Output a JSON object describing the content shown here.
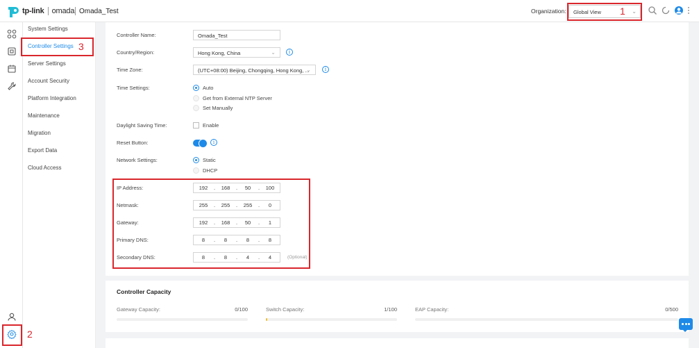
{
  "header": {
    "brand": "tp-link",
    "product": "omada",
    "site_name": "Omada_Test",
    "organization_label": "Organization:",
    "organization_value": "Global View"
  },
  "subnav": {
    "items": [
      {
        "label": "System Settings"
      },
      {
        "label": "Controller Settings"
      },
      {
        "label": "Server Settings"
      },
      {
        "label": "Account Security"
      },
      {
        "label": "Platform Integration"
      },
      {
        "label": "Maintenance"
      },
      {
        "label": "Migration"
      },
      {
        "label": "Export Data"
      },
      {
        "label": "Cloud Access"
      }
    ]
  },
  "form": {
    "controller_name_label": "Controller Name:",
    "controller_name_value": "Omada_Test",
    "country_label": "Country/Region:",
    "country_value": "Hong Kong, China",
    "timezone_label": "Time Zone:",
    "timezone_value": "(UTC+08:00) Beijing, Chongqing, Hong Kong, ...",
    "time_settings_label": "Time Settings:",
    "time_options": [
      "Auto",
      "Get from External NTP Server",
      "Set Manually"
    ],
    "dst_label": "Daylight Saving Time:",
    "dst_option": "Enable",
    "reset_label": "Reset Button:",
    "network_label": "Network Settings:",
    "network_options": [
      "Static",
      "DHCP"
    ],
    "ip_label": "IP Address:",
    "ip": [
      "192",
      "168",
      "50",
      "100"
    ],
    "netmask_label": "Netmask:",
    "netmask": [
      "255",
      "255",
      "255",
      "0"
    ],
    "gateway_label": "Gateway:",
    "gateway": [
      "192",
      "168",
      "50",
      "1"
    ],
    "primary_dns_label": "Primary DNS:",
    "primary_dns": [
      "8",
      "8",
      "8",
      "8"
    ],
    "secondary_dns_label": "Secondary DNS:",
    "secondary_dns": [
      "8",
      "8",
      "4",
      "4"
    ],
    "optional": "(Optional)"
  },
  "capacity": {
    "title": "Controller Capacity",
    "gateway_label": "Gateway Capacity:",
    "gateway_value": "0/100",
    "switch_label": "Switch Capacity:",
    "switch_value": "1/100",
    "eap_label": "EAP Capacity:",
    "eap_value": "0/500"
  },
  "annotations": [
    "1",
    "2",
    "3"
  ],
  "colors": {
    "accent": "#1e8ae8",
    "annotation": "#d9262c",
    "logo_teal": "#20bcd5"
  }
}
